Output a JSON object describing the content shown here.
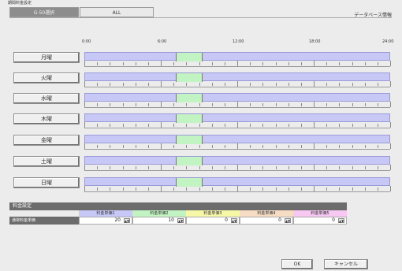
{
  "window": {
    "title": "期間料金設定"
  },
  "tabs": [
    {
      "label": "G-50選択",
      "active": true
    },
    {
      "label": "ALL",
      "active": false
    }
  ],
  "database_info": "データベース情報",
  "time_scale": [
    "0:00",
    "6:00",
    "12:00",
    "18:00",
    "24:00"
  ],
  "days": [
    "月曜",
    "火曜",
    "水曜",
    "木曜",
    "金曜",
    "土曜",
    "日曜"
  ],
  "fee_settings": {
    "section_title": "料金設定",
    "row_label": "通常料金単価",
    "columns": [
      {
        "label": "料金単価1",
        "color": "#c8c8f6",
        "value": "20"
      },
      {
        "label": "料金単価2",
        "color": "#c2f3c2",
        "value": "10"
      },
      {
        "label": "料金単価3",
        "color": "#f7f7a8",
        "value": "0"
      },
      {
        "label": "料金単価4",
        "color": "#f7dcc4",
        "value": "0"
      },
      {
        "label": "料金単価5",
        "color": "#f6c8f2",
        "value": "0"
      }
    ]
  },
  "buttons": {
    "ok": "OK",
    "cancel": "キャンセル"
  },
  "colors": {
    "rate1": "#c8c8f6",
    "rate2": "#c2f3c2",
    "header": "#6c6c6c"
  }
}
